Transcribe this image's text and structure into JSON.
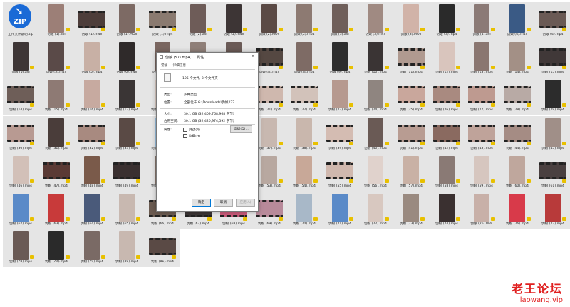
{
  "tiles": [
    {
      "caption": "上传文件说明.zip",
      "type": "zip",
      "zip_label": "ZIP",
      "thumb": "#1a6ad6"
    },
    {
      "caption": "伪娘 (1).avi",
      "type": "portrait",
      "thumb": "#9c7f77"
    },
    {
      "caption": "伪娘 (1).m4v",
      "type": "wide",
      "thumb": "#4d3d3a"
    },
    {
      "caption": "伪娘 (1).MOV",
      "type": "portrait",
      "thumb": "#7d6a64"
    },
    {
      "caption": "伪娘 (1).mp4",
      "type": "wide",
      "thumb": "#8a7a70"
    },
    {
      "caption": "伪娘 (2).avi",
      "type": "portrait",
      "thumb": "#6e5c58"
    },
    {
      "caption": "伪娘 (2).m4v",
      "type": "portrait",
      "thumb": "#3d3535"
    },
    {
      "caption": "伪娘 (2).MOV",
      "type": "portrait",
      "thumb": "#5b4a45"
    },
    {
      "caption": "伪娘 (2).mp4",
      "type": "portrait",
      "thumb": "#8d7a72"
    },
    {
      "caption": "伪娘 (3).avi",
      "type": "portrait",
      "thumb": "#6f5f5a"
    },
    {
      "caption": "伪娘 (3).m4v",
      "type": "portrait",
      "thumb": "#a08a82"
    },
    {
      "caption": "伪娘 (3).MOV",
      "type": "portrait",
      "thumb": "#d1b3a8"
    },
    {
      "caption": "伪娘 (3).mp4",
      "type": "portrait",
      "thumb": "#2a2a2a"
    },
    {
      "caption": "伪娘 (4).avi",
      "type": "portrait",
      "thumb": "#8b7a76"
    },
    {
      "caption": "伪娘 (4).m4v",
      "type": "portrait",
      "thumb": "#3a5a85"
    },
    {
      "caption": "伪娘 (4).mp4",
      "type": "wide",
      "thumb": "#6a5a55"
    },
    {
      "caption": "伪娘 (5).avi",
      "type": "portrait",
      "thumb": "#3e3636"
    },
    {
      "caption": "伪娘 (5).m4v",
      "type": "portrait",
      "thumb": "#5a4a48"
    },
    {
      "caption": "伪娘 (5).mp4",
      "type": "portrait",
      "thumb": "#c8b0a5"
    },
    {
      "caption": "伪娘 (6).m4v",
      "type": "portrait",
      "thumb": "#2f2a2a"
    },
    {
      "caption": "伪娘 (6).mp4",
      "type": "portrait",
      "thumb": "#7a6660"
    },
    {
      "caption": "伪娘 (7).m4v",
      "type": "portrait",
      "thumb": "#8f7f78"
    },
    {
      "caption": "伪娘 (7).mp4",
      "type": "portrait",
      "thumb": "#6a5a56"
    },
    {
      "caption": "伪娘 (8).m4v",
      "type": "wide",
      "thumb": "#554842"
    },
    {
      "caption": "伪娘 (8).mp4",
      "type": "portrait",
      "thumb": "#7e6b65"
    },
    {
      "caption": "伪娘 (9).mp4",
      "type": "portrait",
      "thumb": "#2d2d2d"
    },
    {
      "caption": "伪娘 (10).mp4",
      "type": "portrait",
      "thumb": "#3a3434"
    },
    {
      "caption": "伪娘 (11).mp4",
      "type": "wide",
      "thumb": "#b09a90"
    },
    {
      "caption": "伪娘 (12).mp4",
      "type": "portrait",
      "thumb": "#d9c5bd"
    },
    {
      "caption": "伪娘 (13).mp4",
      "type": "portrait",
      "thumb": "#8a7670"
    },
    {
      "caption": "伪娘 (14).mp4",
      "type": "portrait",
      "thumb": "#a39086"
    },
    {
      "caption": "伪娘 (15).mp4",
      "type": "wide",
      "thumb": "#403838"
    },
    {
      "caption": "伪娘 (14).mp4",
      "type": "wide",
      "thumb": "#6e5e58"
    },
    {
      "caption": "伪娘 (15).mp4",
      "type": "portrait",
      "thumb": "#8e7a74"
    },
    {
      "caption": "伪娘 (16).mp4",
      "type": "portrait",
      "thumb": "#c7aaa0"
    },
    {
      "caption": "伪娘 (17).mp4",
      "type": "portrait",
      "thumb": "#3a3535"
    },
    {
      "caption": "伪娘 (18).mp4",
      "type": "portrait",
      "thumb": "#e0d0c8"
    },
    {
      "caption": "伪娘 (19).mp4",
      "type": "portrait",
      "thumb": "#9a8278"
    },
    {
      "caption": "伪娘 (20).mp4",
      "type": "portrait",
      "thumb": "#b89a90"
    },
    {
      "caption": "伪娘 (21).mp4",
      "type": "wide",
      "thumb": "#cfb8ae"
    },
    {
      "caption": "伪娘 (22).mp4",
      "type": "wide",
      "thumb": "#d2c2ba"
    },
    {
      "caption": "伪娘 (23).mp4",
      "type": "portrait",
      "thumb": "#b6998f"
    },
    {
      "caption": "伪娘 (24).mp4",
      "type": "portrait",
      "thumb": "#8f8580"
    },
    {
      "caption": "伪娘 (25).mp4",
      "type": "wide",
      "thumb": "#c9a79c"
    },
    {
      "caption": "伪娘 (26).mp4",
      "type": "wide",
      "thumb": "#a98a80"
    },
    {
      "caption": "伪娘 (27).mp4",
      "type": "wide",
      "thumb": "#be9a90"
    },
    {
      "caption": "伪娘 (28).mp4",
      "type": "wide",
      "thumb": "#b8aaa5"
    },
    {
      "caption": "伪娘 (29).mp4",
      "type": "portrait",
      "thumb": "#2c2c2c"
    },
    {
      "caption": "伪娘 (30).mp4",
      "type": "wide",
      "thumb": "#b89a92"
    },
    {
      "caption": "伪娘 (31).mp4",
      "type": "portrait",
      "thumb": "#4a3d3a"
    },
    {
      "caption": "伪娘 (32).mp4",
      "type": "wide",
      "thumb": "#a88a80"
    },
    {
      "caption": "伪娘 (33).mp4",
      "type": "portrait",
      "thumb": "#5a4a45"
    },
    {
      "caption": "伪娘 (34).mp4",
      "type": "portrait",
      "thumb": "#9cc4e6"
    },
    {
      "caption": "伪娘 (35).mp4",
      "type": "portrait",
      "thumb": "#3a3535"
    },
    {
      "caption": "伪娘 (36).mp4",
      "type": "portrait",
      "thumb": "#6a5a55"
    },
    {
      "caption": "伪娘 (37).mp4",
      "type": "portrait",
      "thumb": "#c8b8b0"
    },
    {
      "caption": "伪娘 (38).mp4",
      "type": "portrait",
      "thumb": "#c9b7ad"
    },
    {
      "caption": "伪娘 (39).mp4",
      "type": "wide",
      "thumb": "#d4bcb2"
    },
    {
      "caption": "伪娘 (40).mp4",
      "type": "portrait",
      "thumb": "#6a5a55"
    },
    {
      "caption": "伪娘 (41).mp4",
      "type": "wide",
      "thumb": "#b89c92"
    },
    {
      "caption": "伪娘 (42).mp4",
      "type": "wide",
      "thumb": "#8a6a60"
    },
    {
      "caption": "伪娘 (43).mp4",
      "type": "wide",
      "thumb": "#bfa39a"
    },
    {
      "caption": "伪娘 (44).mp4",
      "type": "wide",
      "thumb": "#a58c84"
    },
    {
      "caption": "伪娘 (45).mp4",
      "type": "portrait",
      "thumb": "#a08f88"
    },
    {
      "caption": "伪娘 (46).mp4",
      "type": "portrait",
      "thumb": "#d2c0b8"
    },
    {
      "caption": "伪娘 (47).mp4",
      "type": "wide",
      "thumb": "#5a3a35"
    },
    {
      "caption": "伪娘 (48).mp4",
      "type": "portrait",
      "thumb": "#7a5a4a"
    },
    {
      "caption": "伪娘 (49).mp4",
      "type": "wide",
      "thumb": "#3a3030"
    },
    {
      "caption": "伪娘 (50).mp4",
      "type": "portrait",
      "thumb": "#8a7a70"
    },
    {
      "caption": "伪娘 (51).mp4",
      "type": "portrait",
      "thumb": "#6e5e58"
    },
    {
      "caption": "伪娘 (52).mp4",
      "type": "portrait",
      "thumb": "#5a5050"
    },
    {
      "caption": "伪娘 (53).mp4",
      "type": "portrait",
      "thumb": "#b8a8a0"
    },
    {
      "caption": "伪娘 (54).mp4",
      "type": "portrait",
      "thumb": "#c8a898"
    },
    {
      "caption": "伪娘 (55).mp4",
      "type": "wide",
      "thumb": "#d0b8ae"
    },
    {
      "caption": "伪娘 (56).mp4",
      "type": "portrait",
      "thumb": "#e0d2cc"
    },
    {
      "caption": "伪娘 (57).mp4",
      "type": "portrait",
      "thumb": "#c9b1a5"
    },
    {
      "caption": "伪娘 (58).mp4",
      "type": "portrait",
      "thumb": "#8a7a75"
    },
    {
      "caption": "伪娘 (59).mp4",
      "type": "portrait",
      "thumb": "#d6c6bf"
    },
    {
      "caption": "伪娘 (60).mp4",
      "type": "portrait",
      "thumb": "#bfa79d"
    },
    {
      "caption": "伪娘 (61).mp4",
      "type": "wide",
      "thumb": "#4a4040"
    },
    {
      "caption": "伪娘 (62).mp4",
      "type": "portrait",
      "thumb": "#5a8ac8"
    },
    {
      "caption": "伪娘 (63).mp4",
      "type": "portrait",
      "thumb": "#c83a3a"
    },
    {
      "caption": "伪娘 (64).mp4",
      "type": "portrait",
      "thumb": "#4a5a7a"
    },
    {
      "caption": "伪娘 (65).mp4",
      "type": "portrait",
      "thumb": "#c8b8b0"
    },
    {
      "caption": "伪娘 (66).mp4",
      "type": "wide",
      "thumb": "#6a5a50"
    },
    {
      "caption": "伪娘 (67).mp4",
      "type": "wide",
      "thumb": "#3a3535"
    },
    {
      "caption": "伪娘 (68).mp4",
      "type": "wide",
      "thumb": "#c85a7a"
    },
    {
      "caption": "伪娘 (69).mp4",
      "type": "wide",
      "thumb": "#b88a9a"
    },
    {
      "caption": "伪娘 (70).mp4",
      "type": "portrait",
      "thumb": "#a8b8c8"
    },
    {
      "caption": "伪娘 (71).mp4",
      "type": "portrait",
      "thumb": "#5a8ac8"
    },
    {
      "caption": "伪娘 (72).mp4",
      "type": "portrait",
      "thumb": "#d8c8c0"
    },
    {
      "caption": "伪娘 (73).mp4",
      "type": "portrait",
      "thumb": "#9a8a80"
    },
    {
      "caption": "伪娘 (74).mp4",
      "type": "portrait",
      "thumb": "#3a3030"
    },
    {
      "caption": "伪娘 (75).MP4",
      "type": "portrait",
      "thumb": "#c8b0a8"
    },
    {
      "caption": "伪娘 (76).mp4",
      "type": "portrait",
      "thumb": "#d83a4a"
    },
    {
      "caption": "伪娘 (77).mp4",
      "type": "portrait",
      "thumb": "#b83a3a"
    },
    {
      "caption": "伪娘 (78).mp4",
      "type": "portrait",
      "thumb": "#6a5a55"
    },
    {
      "caption": "伪娘 (79).mp4",
      "type": "portrait",
      "thumb": "#2a2a2a"
    },
    {
      "caption": "伪娘 (79).mp4",
      "type": "portrait",
      "thumb": "#7a6a65"
    },
    {
      "caption": "伪娘 (80).mp4",
      "type": "portrait",
      "thumb": "#c8b8b0"
    },
    {
      "caption": "伪娘 (81).mp4",
      "type": "wide",
      "thumb": "#5a4a45"
    }
  ],
  "dialog": {
    "title": "伪娘 (57).mp4, ... 属性",
    "close_glyph": "✕",
    "tabs": [
      "常规",
      "详细信息"
    ],
    "summary": "105 个文件, 3 个文件夹",
    "type_label": "类型:",
    "type_value": "多种类型",
    "location_label": "位置:",
    "location_value": "全部位于 G:\\Downloads\\伪娘222",
    "size_label": "大小:",
    "size_value": "30.1 GB (32,409,768,968 字节)",
    "disk_label": "占用空间:",
    "disk_value": "30.1 GB (32,420,974,592 字节)",
    "attr_label": "属性:",
    "readonly_label": "只读(R)",
    "hidden_label": "隐藏(H)",
    "advanced_label": "高级(D)...",
    "ok_label": "确定",
    "cancel_label": "取消",
    "apply_label": "应用(A)"
  },
  "watermark": {
    "line1": "老王论坛",
    "line2": "laowang.vip"
  }
}
